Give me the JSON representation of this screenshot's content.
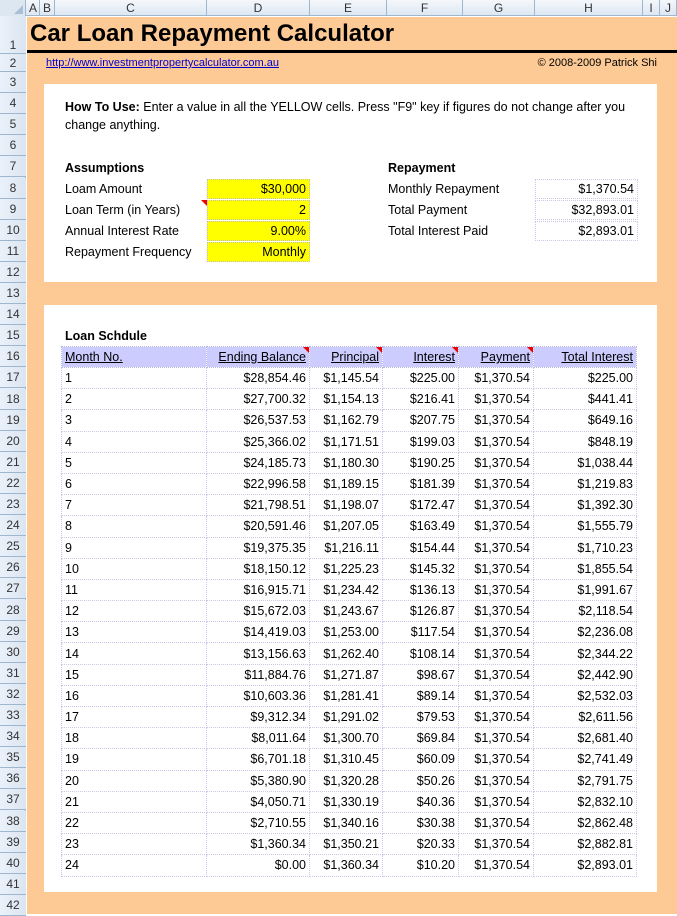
{
  "spreadsheet": {
    "columns": [
      "A",
      "B",
      "C",
      "D",
      "E",
      "F",
      "G",
      "H",
      "I",
      "J"
    ],
    "rows": [
      "1",
      "2",
      "3",
      "4",
      "5",
      "6",
      "7",
      "8",
      "9",
      "10",
      "11",
      "12",
      "13",
      "14",
      "15",
      "16",
      "17",
      "18",
      "19",
      "20",
      "21",
      "22",
      "23",
      "24",
      "25",
      "26",
      "27",
      "28",
      "29",
      "30",
      "31",
      "32",
      "33",
      "34",
      "35",
      "36",
      "37",
      "38",
      "39",
      "40",
      "41",
      "42"
    ]
  },
  "header": {
    "title": "Car Loan Repayment Calculator",
    "link": "http://www.investmentpropertycalculator.com.au",
    "copyright": "© 2008-2009 Patrick Shi"
  },
  "howto": {
    "label": "How To Use:",
    "text": " Enter a value in all the YELLOW cells. Press \"F9\" key if figures do not change after you change anything."
  },
  "assumptions": {
    "heading": "Assumptions",
    "items": [
      {
        "label": "Loam Amount",
        "value": "$30,000"
      },
      {
        "label": "Loan Term (in Years)",
        "value": "2"
      },
      {
        "label": "Annual Interest Rate",
        "value": "9.00%"
      },
      {
        "label": "Repayment Frequency",
        "value": "Monthly"
      }
    ]
  },
  "repayment": {
    "heading": "Repayment",
    "items": [
      {
        "label": "Monthly Repayment",
        "value": "$1,370.54"
      },
      {
        "label": "Total Payment",
        "value": "$32,893.01"
      },
      {
        "label": "Total Interest Paid",
        "value": "$2,893.01"
      }
    ]
  },
  "schedule": {
    "heading": "Loan Schdule",
    "columns": [
      "Month No.",
      "Ending Balance",
      "Principal",
      "Interest",
      "Payment",
      "Total Interest"
    ],
    "rows": [
      [
        "1",
        "$28,854.46",
        "$1,145.54",
        "$225.00",
        "$1,370.54",
        "$225.00"
      ],
      [
        "2",
        "$27,700.32",
        "$1,154.13",
        "$216.41",
        "$1,370.54",
        "$441.41"
      ],
      [
        "3",
        "$26,537.53",
        "$1,162.79",
        "$207.75",
        "$1,370.54",
        "$649.16"
      ],
      [
        "4",
        "$25,366.02",
        "$1,171.51",
        "$199.03",
        "$1,370.54",
        "$848.19"
      ],
      [
        "5",
        "$24,185.73",
        "$1,180.30",
        "$190.25",
        "$1,370.54",
        "$1,038.44"
      ],
      [
        "6",
        "$22,996.58",
        "$1,189.15",
        "$181.39",
        "$1,370.54",
        "$1,219.83"
      ],
      [
        "7",
        "$21,798.51",
        "$1,198.07",
        "$172.47",
        "$1,370.54",
        "$1,392.30"
      ],
      [
        "8",
        "$20,591.46",
        "$1,207.05",
        "$163.49",
        "$1,370.54",
        "$1,555.79"
      ],
      [
        "9",
        "$19,375.35",
        "$1,216.11",
        "$154.44",
        "$1,370.54",
        "$1,710.23"
      ],
      [
        "10",
        "$18,150.12",
        "$1,225.23",
        "$145.32",
        "$1,370.54",
        "$1,855.54"
      ],
      [
        "11",
        "$16,915.71",
        "$1,234.42",
        "$136.13",
        "$1,370.54",
        "$1,991.67"
      ],
      [
        "12",
        "$15,672.03",
        "$1,243.67",
        "$126.87",
        "$1,370.54",
        "$2,118.54"
      ],
      [
        "13",
        "$14,419.03",
        "$1,253.00",
        "$117.54",
        "$1,370.54",
        "$2,236.08"
      ],
      [
        "14",
        "$13,156.63",
        "$1,262.40",
        "$108.14",
        "$1,370.54",
        "$2,344.22"
      ],
      [
        "15",
        "$11,884.76",
        "$1,271.87",
        "$98.67",
        "$1,370.54",
        "$2,442.90"
      ],
      [
        "16",
        "$10,603.36",
        "$1,281.41",
        "$89.14",
        "$1,370.54",
        "$2,532.03"
      ],
      [
        "17",
        "$9,312.34",
        "$1,291.02",
        "$79.53",
        "$1,370.54",
        "$2,611.56"
      ],
      [
        "18",
        "$8,011.64",
        "$1,300.70",
        "$69.84",
        "$1,370.54",
        "$2,681.40"
      ],
      [
        "19",
        "$6,701.18",
        "$1,310.45",
        "$60.09",
        "$1,370.54",
        "$2,741.49"
      ],
      [
        "20",
        "$5,380.90",
        "$1,320.28",
        "$50.26",
        "$1,370.54",
        "$2,791.75"
      ],
      [
        "21",
        "$4,050.71",
        "$1,330.19",
        "$40.36",
        "$1,370.54",
        "$2,832.10"
      ],
      [
        "22",
        "$2,710.55",
        "$1,340.16",
        "$30.38",
        "$1,370.54",
        "$2,862.48"
      ],
      [
        "23",
        "$1,360.34",
        "$1,350.21",
        "$20.33",
        "$1,370.54",
        "$2,882.81"
      ],
      [
        "24",
        "$0.00",
        "$1,360.34",
        "$10.20",
        "$1,370.54",
        "$2,893.01"
      ]
    ]
  },
  "colors": {
    "background": "#fdca96",
    "input_yellow": "#ffff00",
    "table_header": "#ccccff",
    "comment_marker": "#ee0000"
  }
}
